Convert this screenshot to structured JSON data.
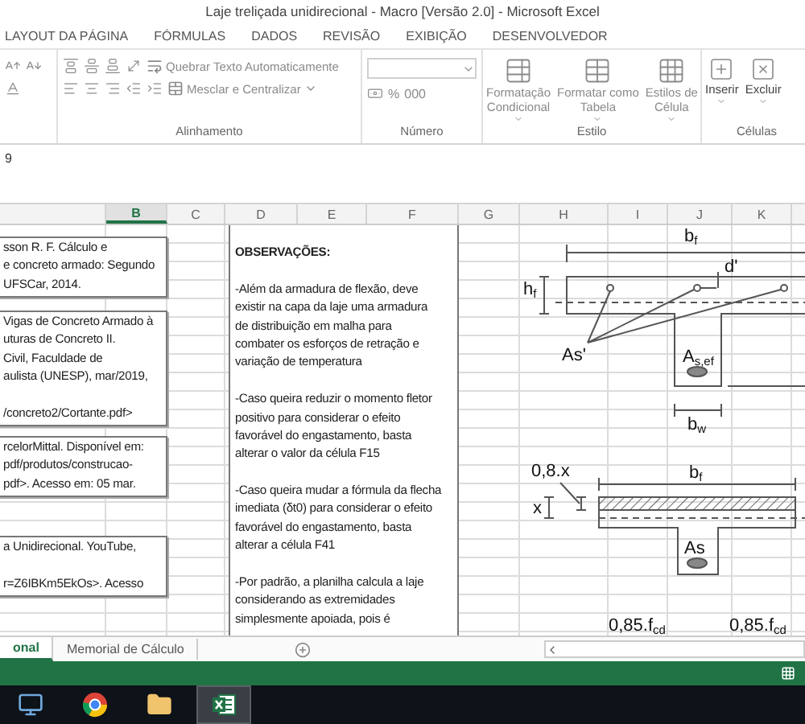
{
  "window": {
    "title": "Laje treliçada unidirecional - Macro [Versão 2.0] - Microsoft Excel"
  },
  "ribbon_tabs": [
    {
      "label": "LAYOUT DA PÁGINA",
      "selected": false
    },
    {
      "label": "FÓRMULAS",
      "selected": false
    },
    {
      "label": "DADOS",
      "selected": false
    },
    {
      "label": "REVISÃO",
      "selected": false
    },
    {
      "label": "EXIBIÇÃO",
      "selected": false
    },
    {
      "label": "DESENVOLVEDOR",
      "selected": false
    }
  ],
  "ribbon": {
    "alignment": {
      "label": "Alinhamento",
      "wrap_text": "Quebrar Texto Automaticamente",
      "merge": "Mesclar e Centralizar"
    },
    "number": {
      "label": "Número",
      "percent": "%",
      "thousands": "000"
    },
    "styles": {
      "label": "Estilo",
      "buttons": [
        {
          "lines": [
            "Formatação",
            "Condicional"
          ]
        },
        {
          "lines": [
            "Formatar como",
            "Tabela"
          ]
        },
        {
          "lines": [
            "Estilos de",
            "Célula"
          ]
        }
      ]
    },
    "cells": {
      "label": "Células",
      "buttons": [
        "Inserir",
        "Excluir"
      ]
    }
  },
  "formula_bar": {
    "value": "9"
  },
  "columns": [
    {
      "label": "B",
      "selected": true
    },
    {
      "label": "C",
      "selected": false
    },
    {
      "label": "D",
      "selected": false
    },
    {
      "label": "E",
      "selected": false
    },
    {
      "label": "F",
      "selected": false
    },
    {
      "label": "G",
      "selected": false
    },
    {
      "label": "H",
      "selected": false
    },
    {
      "label": "I",
      "selected": false
    },
    {
      "label": "J",
      "selected": false
    },
    {
      "label": "K",
      "selected": false
    }
  ],
  "reference_boxes": [
    {
      "blocks": [
        [
          "sson R. F. Cálculo e",
          "e concreto armado: Segundo",
          "UFSCar, 2014."
        ]
      ]
    },
    {
      "blocks": [
        [
          "Vigas de Concreto Armado à",
          "uturas de Concreto II.",
          "Civil, Faculdade de",
          "aulista (UNESP), mar/2019,"
        ],
        [
          "/concreto2/Cortante.pdf>"
        ]
      ]
    },
    {
      "blocks": [
        [
          "rcelorMittal. Disponível em:",
          "pdf/produtos/construcao-",
          "pdf>. Acesso em: 05 mar."
        ]
      ]
    },
    {
      "blocks": [
        [
          "a Unidirecional. YouTube,"
        ],
        [
          "r=Z6IBKm5EkOs>. Acesso"
        ]
      ]
    }
  ],
  "notes": {
    "title": "OBSERVAÇÕES:",
    "paragraphs": [
      {
        "lines": [
          "-Além da armadura de flexão, deve",
          "existir na capa da laje uma armadura",
          "de distribuição em malha para",
          "combater os esforços de retração e",
          "variação de temperatura"
        ]
      },
      {
        "lines": [
          "-Caso queira reduzir o momento fletor",
          "positivo para considerar o efeito",
          "favorável do engastamento, basta",
          "alterar o valor da célula F15"
        ]
      },
      {
        "lines": [
          "-Caso queira mudar a fórmula da flecha",
          "imediata (δt0) para considerar o efeito",
          "favorável do engastamento, basta",
          "alterar a célula F41"
        ]
      },
      {
        "lines": [
          "-Por padrão, a planilha calcula a laje",
          "considerando as extremidades",
          "simplesmente apoiada, pois é"
        ]
      }
    ]
  },
  "diagram": {
    "labels": [
      "b$_{f}$",
      "h$_{f}$",
      "d'",
      "As'",
      "A$_{s,ef}$",
      "b$_{w}$",
      "0,8.x",
      "b$_{f}$",
      "x",
      "As",
      "0,85.f$_{cd}$",
      "0,85.f$_{cd}$"
    ]
  },
  "sheet_tabs": [
    {
      "label": "onal",
      "selected": true
    },
    {
      "label": "Memorial de Cálculo",
      "selected": false
    }
  ],
  "taskbar": {
    "items": [
      {
        "kind": "computer",
        "selected": false
      },
      {
        "kind": "browser",
        "selected": false
      },
      {
        "kind": "folder",
        "selected": false
      },
      {
        "kind": "spreadsheet",
        "selected": true
      }
    ]
  }
}
